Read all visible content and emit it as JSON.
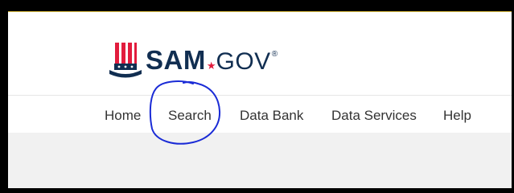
{
  "header": {
    "logo": {
      "brand_main": "SAM",
      "brand_dot": "★",
      "brand_tld": "GOV",
      "registered": "®"
    }
  },
  "nav": {
    "items": [
      {
        "label": "Home"
      },
      {
        "label": "Search"
      },
      {
        "label": "Data Bank"
      },
      {
        "label": "Data Services"
      },
      {
        "label": "Help"
      }
    ]
  },
  "colors": {
    "brand_navy": "#112e51",
    "accent_red": "#e21c3d",
    "annotation_circle": "#1a2bd6",
    "top_rule": "#e8c94a"
  },
  "annotation": {
    "type": "hand-drawn circle",
    "target": "Search"
  }
}
